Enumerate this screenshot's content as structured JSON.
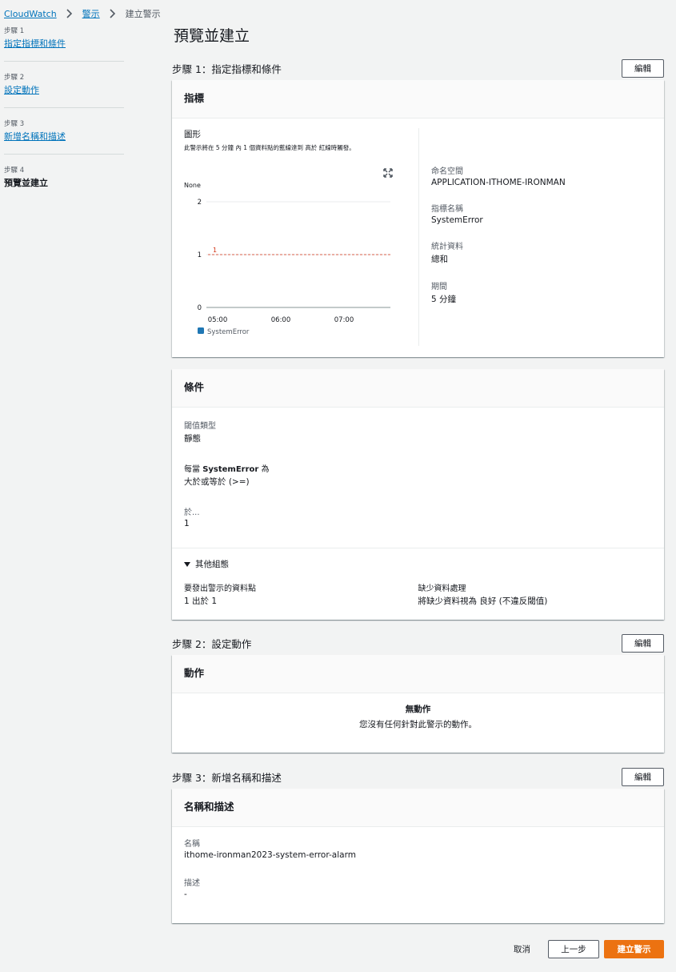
{
  "breadcrumb": {
    "items": [
      "CloudWatch",
      "警示"
    ],
    "current": "建立警示"
  },
  "steps": [
    {
      "num": "步驟 1",
      "name": "指定指標和條件"
    },
    {
      "num": "步驟 2",
      "name": "設定動作"
    },
    {
      "num": "步驟 3",
      "name": "新增名稱和描述"
    },
    {
      "num": "步驟 4",
      "name": "預覽並建立"
    }
  ],
  "page_title": "預覽並建立",
  "edit_label": "編輯",
  "section1": {
    "title": "步驟 1：指定指標和條件",
    "metric_card": {
      "title": "指標",
      "graph_title": "圖形",
      "graph_desc": "此警示將在 5 分鐘 內 1 個資料點的藍線達到 高於 紅線時觸發。",
      "fields": [
        {
          "k": "命名空間",
          "v": "APPLICATION-ITHOME-IRONMAN"
        },
        {
          "k": "指標名稱",
          "v": "SystemError"
        },
        {
          "k": "統計資料",
          "v": "總和"
        },
        {
          "k": "期間",
          "v": "5 分鐘"
        }
      ]
    },
    "conditions_card": {
      "title": "條件",
      "threshold_type_label": "閾值類型",
      "threshold_type": "靜態",
      "whenever_prefix": "每當 ",
      "whenever_metric": "SystemError",
      "whenever_suffix": " 為",
      "operator": "大於或等於 (>=)",
      "than_label": "於...",
      "than_value": "1",
      "extra_toggle": "其他組態",
      "datapoints_label": "要發出警示的資料點",
      "datapoints_value": "1 出於 1",
      "missing_label": "缺少資料處理",
      "missing_value": "將缺少資料視為 良好 (不違反閾值)"
    }
  },
  "section2": {
    "title": "步驟 2：設定動作",
    "card_title": "動作",
    "empty_title": "無動作",
    "empty_desc": "您沒有任何針對此警示的動作。"
  },
  "section3": {
    "title": "步驟 3：新增名稱和描述",
    "card_title": "名稱和描述",
    "name_label": "名稱",
    "name_value": "ithome-ironman2023-system-error-alarm",
    "desc_label": "描述",
    "desc_value": "-"
  },
  "footer": {
    "cancel": "取消",
    "previous": "上一步",
    "create": "建立警示"
  },
  "chart_data": {
    "type": "line",
    "unit_label": "None",
    "y_ticks": [
      0,
      1,
      2
    ],
    "ylim": [
      0,
      2
    ],
    "x_ticks": [
      "05:00",
      "06:00",
      "07:00"
    ],
    "series": [
      {
        "name": "SystemError",
        "values": []
      }
    ],
    "threshold": {
      "value": 1,
      "label": "1"
    },
    "colors": {
      "series": "#1f77b4",
      "threshold": "#d13212",
      "grid": "#e9ebed",
      "axis": "#879596"
    },
    "legend": "bottom-left"
  }
}
